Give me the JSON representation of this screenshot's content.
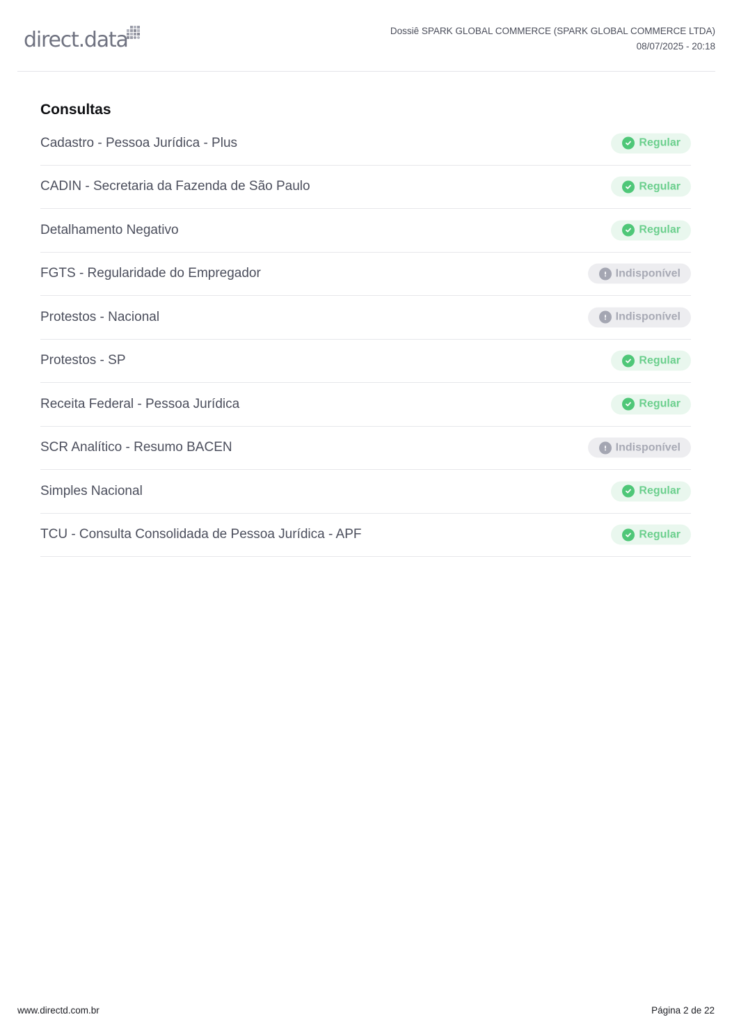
{
  "header": {
    "logo_text": "direct.data",
    "doc_title": "Dossiê SPARK GLOBAL COMMERCE (SPARK GLOBAL COMMERCE LTDA)",
    "doc_datetime": "08/07/2025 - 20:18"
  },
  "section": {
    "title": "Consultas",
    "items": [
      {
        "label": "Cadastro - Pessoa Jurídica - Plus",
        "status": "Regular"
      },
      {
        "label": "CADIN - Secretaria da Fazenda de São Paulo",
        "status": "Regular"
      },
      {
        "label": "Detalhamento Negativo",
        "status": "Regular"
      },
      {
        "label": "FGTS - Regularidade do Empregador",
        "status": "Indisponível"
      },
      {
        "label": "Protestos - Nacional",
        "status": "Indisponível"
      },
      {
        "label": "Protestos - SP",
        "status": "Regular"
      },
      {
        "label": "Receita Federal - Pessoa Jurídica",
        "status": "Regular"
      },
      {
        "label": "SCR Analítico - Resumo BACEN",
        "status": "Indisponível"
      },
      {
        "label": "Simples Nacional",
        "status": "Regular"
      },
      {
        "label": "TCU - Consulta Consolidada de Pessoa Jurídica - APF",
        "status": "Regular"
      }
    ]
  },
  "footer": {
    "website": "www.directd.com.br",
    "page": "Página 2 de 22"
  },
  "colors": {
    "regular_badge_bg": "#e9f7ee",
    "regular_badge_text": "#6bcf8d",
    "unavailable_badge_bg": "#ededf0",
    "unavailable_badge_text": "#a8aab5"
  },
  "icons": {
    "regular": "check-circle-icon",
    "unavailable": "exclamation-circle-icon"
  }
}
